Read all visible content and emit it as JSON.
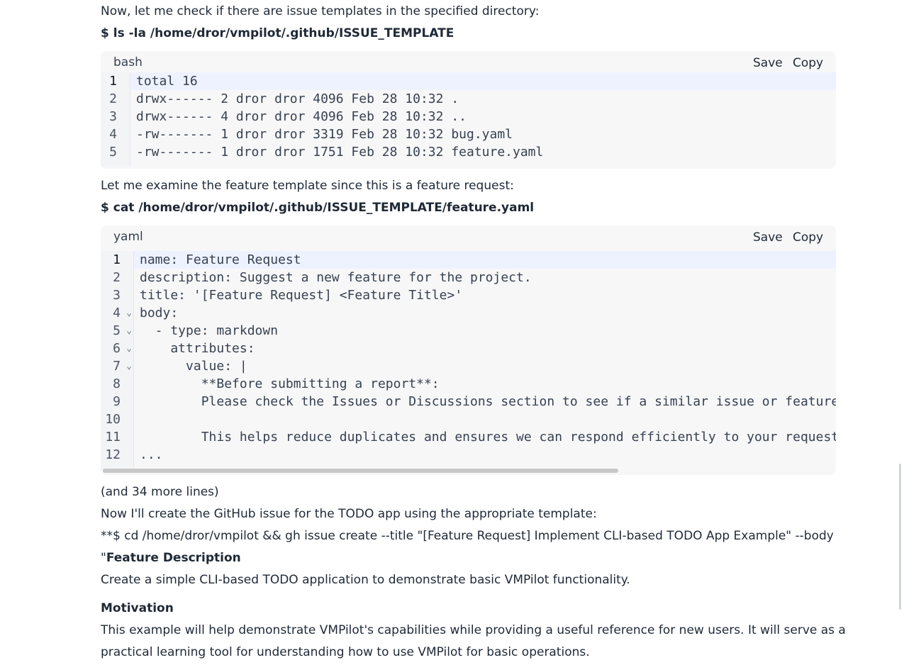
{
  "intro_text": "Now, let me check if there are issue templates in the specified directory:",
  "cmd1": "$ ls -la /home/dror/vmpilot/.github/ISSUE_TEMPLATE",
  "block1": {
    "lang": "bash",
    "save_label": "Save",
    "copy_label": "Copy",
    "line_numbers": [
      "1",
      "2",
      "3",
      "4",
      "5"
    ],
    "lines": [
      "total 16",
      "drwx------ 2 dror dror 4096 Feb 28 10:32 .",
      "drwx------ 4 dror dror 4096 Feb 28 10:32 ..",
      "-rw------- 1 dror dror 3319 Feb 28 10:32 bug.yaml",
      "-rw------- 1 dror dror 1751 Feb 28 10:32 feature.yaml"
    ]
  },
  "text2": "Let me examine the feature template since this is a feature request:",
  "cmd2": "$ cat /home/dror/vmpilot/.github/ISSUE_TEMPLATE/feature.yaml",
  "block2": {
    "lang": "yaml",
    "save_label": "Save",
    "copy_label": "Copy",
    "line_numbers": [
      "1",
      "2",
      "3",
      "4",
      "5",
      "6",
      "7",
      "8",
      "9",
      "10",
      "11",
      "12"
    ],
    "fold_icon": "⌄",
    "lines": [
      "name: Feature Request",
      "description: Suggest a new feature for the project.",
      "title: '[Feature Request] <Feature Title>'",
      "body:",
      "  - type: markdown",
      "    attributes:",
      "      value: |",
      "        **Before submitting a report**:",
      "        Please check the Issues or Discussions section to see if a similar issue or feature",
      "",
      "        This helps reduce duplicates and ensures we can respond efficiently to your request.",
      "..."
    ]
  },
  "more_lines": "(and 34 more lines)",
  "text3": "Now I'll create the GitHub issue for the TODO app using the appropriate template:",
  "cmd3_line1": "**$ cd /home/dror/vmpilot && gh issue create --title \"[Feature Request] Implement CLI-based TODO App Example\" --body",
  "cmd3_quote": "\"",
  "heading_feature": "Feature Description",
  "feature_desc": "Create a simple CLI-based TODO application to demonstrate basic VMPilot functionality.",
  "heading_motivation": "Motivation",
  "motivation_line1": "This example will help demonstrate VMPilot's capabilities while providing a useful reference for new users. It will serve as a",
  "motivation_line2": "practical learning tool for understanding how to use VMPilot for basic operations."
}
